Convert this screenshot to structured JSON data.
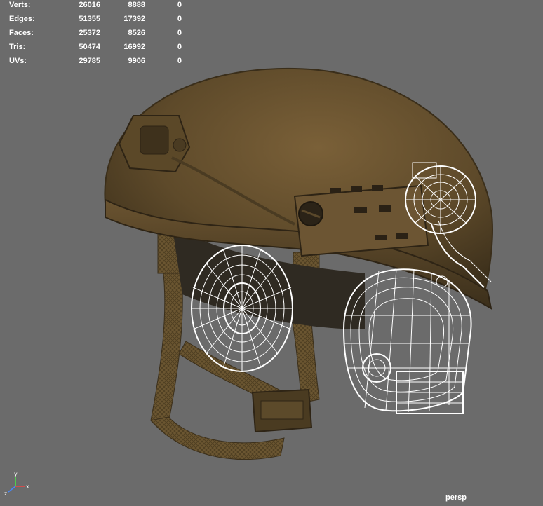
{
  "viewport": {
    "camera": "persp",
    "background": "#6b6b6b",
    "heads_up_display": {
      "rows": [
        {
          "label": "Verts:",
          "values": [
            "26016",
            "8888",
            "0"
          ]
        },
        {
          "label": "Edges:",
          "values": [
            "51355",
            "17392",
            "0"
          ]
        },
        {
          "label": "Faces:",
          "values": [
            "25372",
            "8526",
            "0"
          ]
        },
        {
          "label": "Tris:",
          "values": [
            "50474",
            "16992",
            "0"
          ]
        },
        {
          "label": "UVs:",
          "values": [
            "29785",
            "9906",
            "0"
          ]
        }
      ]
    },
    "axis_indicator": {
      "y": "y",
      "z": "z",
      "x": "x"
    },
    "model_colors": {
      "helmet": "#6e5632",
      "wireframe": "#ffffff",
      "strap": "#6a5530"
    }
  }
}
